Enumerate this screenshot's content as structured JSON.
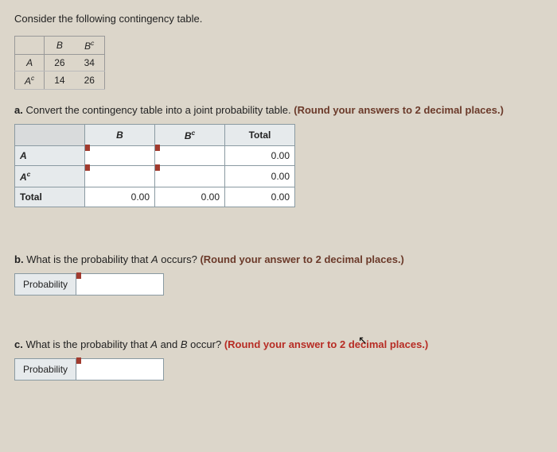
{
  "intro": "Consider the following contingency table.",
  "contingency": {
    "col_headers": [
      "B",
      "Bᶜ"
    ],
    "row_headers": [
      "A",
      "Aᶜ"
    ],
    "rows": [
      [
        "26",
        "34"
      ],
      [
        "14",
        "26"
      ]
    ]
  },
  "part_a": {
    "label": "a.",
    "text": "Convert the contingency table into a joint probability table.",
    "round": "(Round your answers to 2 decimal places.)"
  },
  "joint_table": {
    "col_headers": [
      "B",
      "Bᶜ",
      "Total"
    ],
    "row_headers": [
      "A",
      "Aᶜ",
      "Total"
    ],
    "cells": {
      "r0c0": "",
      "r0c1": "",
      "r0c2": "0.00",
      "r1c0": "",
      "r1c1": "",
      "r1c2": "0.00",
      "r2c0": "0.00",
      "r2c1": "0.00",
      "r2c2": "0.00"
    }
  },
  "part_b": {
    "label": "b.",
    "text": "What is the probability that A occurs?",
    "round": "(Round your answer to 2 decimal places.)",
    "field_label": "Probability",
    "value": ""
  },
  "part_c": {
    "label": "c.",
    "text": "What is the probability that A and B occur?",
    "round": "(Round your answer to 2 decimal places.)",
    "field_label": "Probability",
    "value": ""
  }
}
